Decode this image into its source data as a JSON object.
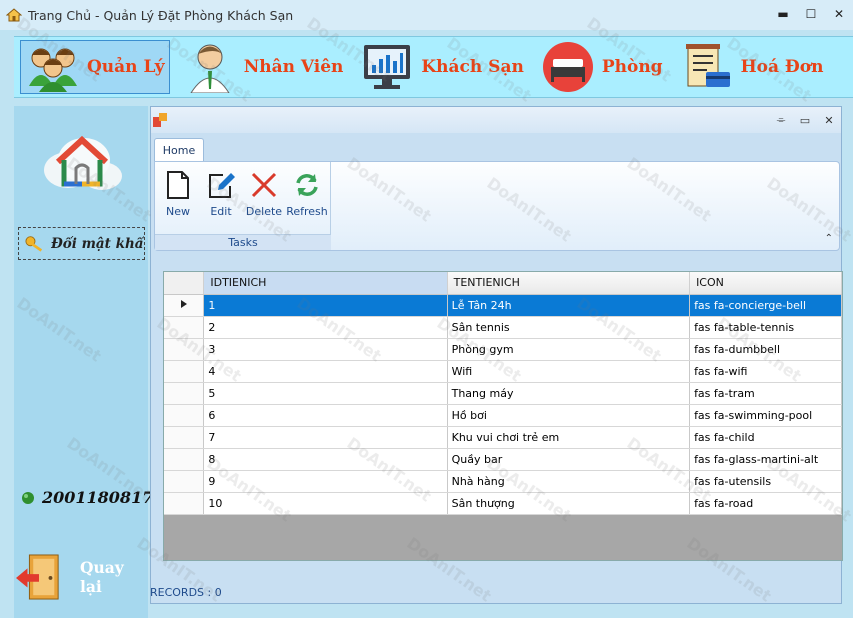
{
  "window": {
    "title": "Trang Chủ - Quản Lý Đặt Phòng Khách Sạn",
    "minimize": "▬",
    "maximize": "☐",
    "close": "✕"
  },
  "topnav": [
    {
      "label": "Quản Lý",
      "icon": "group-people-icon",
      "active": true
    },
    {
      "label": "Nhân Viên",
      "icon": "staff-person-icon",
      "active": false
    },
    {
      "label": "Khách Sạn",
      "icon": "monitor-chart-icon",
      "active": false
    },
    {
      "label": "Phòng",
      "icon": "bed-icon",
      "active": false
    },
    {
      "label": "Hoá Đơn",
      "icon": "invoice-icon",
      "active": false
    }
  ],
  "sidebar": {
    "change_password": "Đổi mật khẩu",
    "user_code": "2001180817",
    "back": "Quay lại"
  },
  "child": {
    "buttons": {
      "pin": "⌯",
      "restore": "▭",
      "close": "✕"
    },
    "tab": "Home",
    "ribbon": {
      "group": "Tasks",
      "buttons": [
        {
          "label": "New",
          "icon": "new-file-icon"
        },
        {
          "label": "Edit",
          "icon": "edit-pencil-icon"
        },
        {
          "label": "Delete",
          "icon": "delete-x-icon"
        },
        {
          "label": "Refresh",
          "icon": "refresh-icon"
        }
      ],
      "collapse": "⌃"
    }
  },
  "grid": {
    "columns": [
      "IDTIENICH",
      "TENTIENICH",
      "ICON"
    ],
    "rows": [
      [
        "1",
        "Lễ Tân 24h",
        "fas fa-concierge-bell"
      ],
      [
        "2",
        "Sân tennis",
        "fas fa-table-tennis"
      ],
      [
        "3",
        "Phòng gym",
        "fas fa-dumbbell"
      ],
      [
        "4",
        "Wifi",
        "fas fa-wifi"
      ],
      [
        "5",
        "Thang máy",
        "fas fa-tram"
      ],
      [
        "6",
        "Hồ bơi",
        "fas fa-swimming-pool"
      ],
      [
        "7",
        "Khu vui chơi trẻ em",
        "fas fa-child"
      ],
      [
        "8",
        "Quầy bar",
        "fas fa-glass-martini-alt"
      ],
      [
        "9",
        "Nhà hàng",
        "fas fa-utensils"
      ],
      [
        "10",
        "Sân thượng",
        "fas fa-road"
      ]
    ],
    "selected_row": 0
  },
  "status": "RECORDS : 0",
  "watermark": "DoAnIT.net",
  "colors": {
    "nav_label": "#e84418",
    "selection": "#0a7ad5",
    "ribbon_text": "#1f4b8c"
  }
}
